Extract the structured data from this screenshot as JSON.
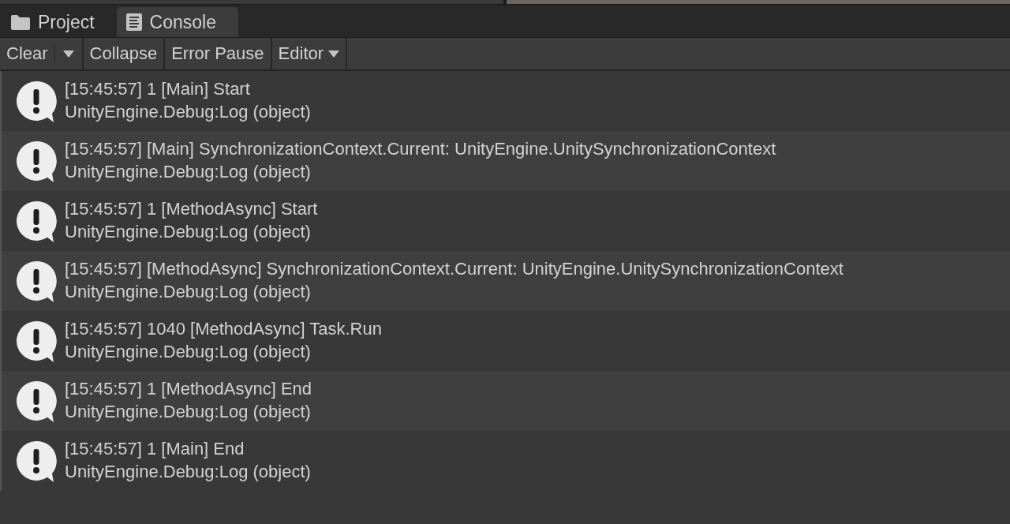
{
  "tabs": [
    {
      "label": "Project",
      "kind": "folder",
      "selected": false
    },
    {
      "label": "Console",
      "kind": "document",
      "selected": true
    }
  ],
  "toolbar": [
    {
      "label": "Clear",
      "kind": "split"
    },
    {
      "label": "Collapse",
      "kind": "toggle",
      "on": false
    },
    {
      "label": "Error Pause",
      "kind": "toggle",
      "on": false
    },
    {
      "label": "Editor",
      "kind": "dropdown"
    }
  ],
  "log_entries": [
    {
      "message": "[15:45:57] 1 [Main] Start",
      "trace": "UnityEngine.Debug:Log (object)"
    },
    {
      "message": "[15:45:57] [Main] SynchronizationContext.Current: UnityEngine.UnitySynchronizationContext",
      "trace": "UnityEngine.Debug:Log (object)"
    },
    {
      "message": "[15:45:57] 1 [MethodAsync] Start",
      "trace": "UnityEngine.Debug:Log (object)"
    },
    {
      "message": "[15:45:57] [MethodAsync] SynchronizationContext.Current: UnityEngine.UnitySynchronizationContext",
      "trace": "UnityEngine.Debug:Log (object)"
    },
    {
      "message": "[15:45:57] 1040 [MethodAsync] Task.Run",
      "trace": "UnityEngine.Debug:Log (object)"
    },
    {
      "message": "[15:45:57] 1 [MethodAsync] End",
      "trace": "UnityEngine.Debug:Log (object)"
    },
    {
      "message": "[15:45:57] 1 [Main] End",
      "trace": "UnityEngine.Debug:Log (object)"
    }
  ]
}
